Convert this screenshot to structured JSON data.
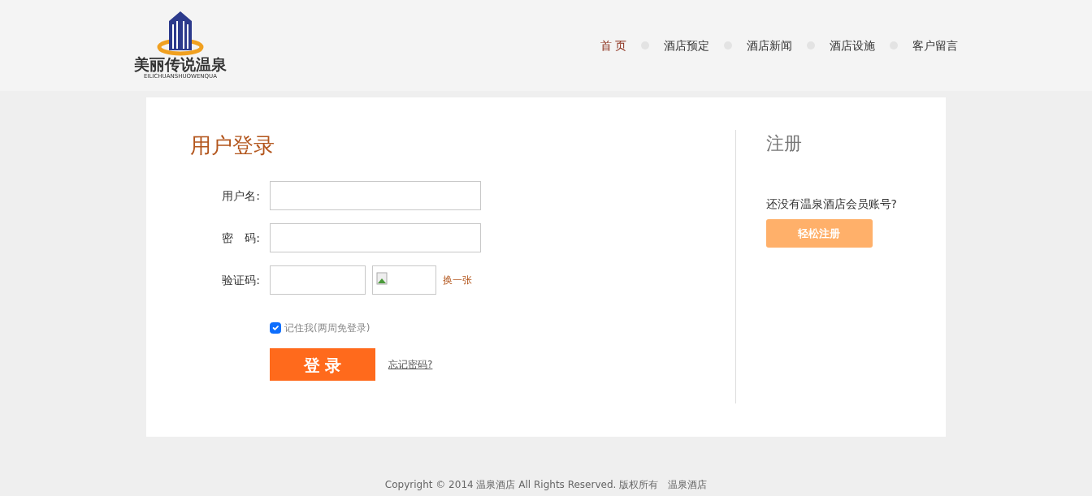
{
  "logo": {
    "title": "美丽传说温泉",
    "subtitle": "EILICHUANSHUOWENQUA"
  },
  "nav": [
    {
      "label": "首 页",
      "selected": true
    },
    {
      "label": "酒店预定",
      "selected": false
    },
    {
      "label": "酒店新闻",
      "selected": false
    },
    {
      "label": "酒店设施",
      "selected": false
    },
    {
      "label": "客户留言",
      "selected": false
    }
  ],
  "login": {
    "title": "用户登录",
    "fields": [
      {
        "label": "用户名:",
        "kind": "text"
      },
      {
        "label": "密　码:",
        "kind": "password"
      },
      {
        "label": "验证码:",
        "kind": "captcha",
        "refresh_link": "换一张"
      }
    ],
    "remember": {
      "label": "记住我(两周免登录)",
      "checked": true
    },
    "submit": "登 录",
    "forgot_link": "忘记密码?"
  },
  "register": {
    "title": "注册",
    "prompt": "还没有温泉酒店会员账号?",
    "button": "轻松注册"
  },
  "footer": "Copyright © 2014 温泉酒店 All Rights Reserved. 版权所有　温泉酒店"
}
